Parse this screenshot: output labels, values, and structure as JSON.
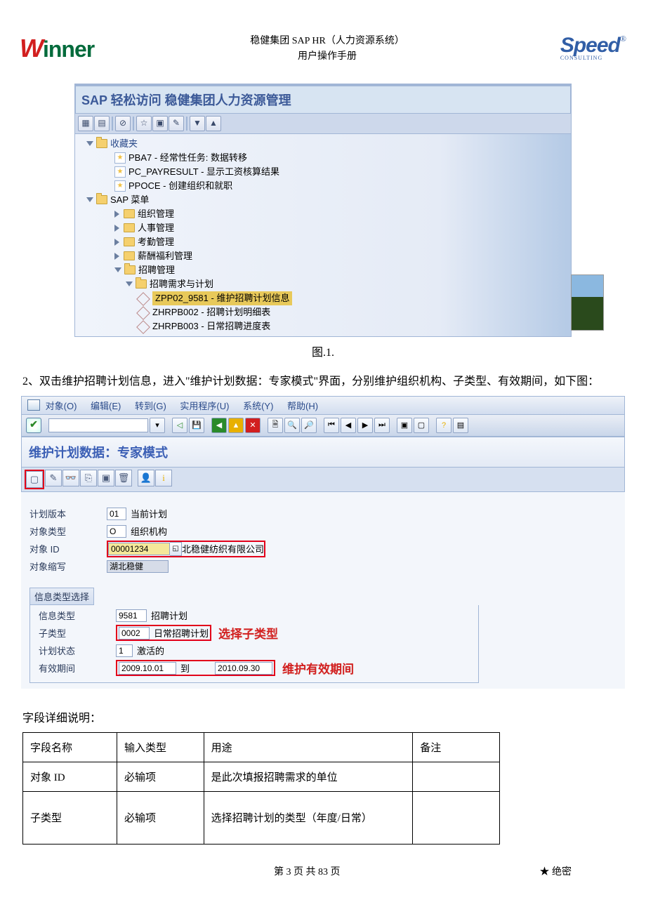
{
  "header": {
    "center_line1": "稳健集团 SAP HR（人力资源系统）",
    "center_line2": "用户操作手册",
    "logo_left": "Winner",
    "logo_right": "Speed",
    "logo_right_sub": "CONSULTING"
  },
  "screenshot1": {
    "title": "SAP 轻松访问 稳健集团人力资源管理",
    "tree": {
      "favorites": "收藏夹",
      "fav1": "PBA7 - 经常性任务: 数据转移",
      "fav2": "PC_PAYRESULT - 显示工资核算结果",
      "fav3": "PPOCE - 创建组织和就职",
      "sapmenu": "SAP 菜单",
      "org": "组织管理",
      "hr": "人事管理",
      "time": "考勤管理",
      "pay": "薪酬福利管理",
      "recruit": "招聘管理",
      "reqplan": "招聘需求与计划",
      "item_highlight": "ZPP02_9581 - 维护招聘计划信息",
      "item2": "ZHRPB002 - 招聘计划明细表",
      "item3": "ZHRPB003 - 日常招聘进度表"
    }
  },
  "figcaption1": "图.1.",
  "paragraph2": "2、双击维护招聘计划信息，进入\"维护计划数据：专家模式\"界面，分别维护组织机构、子类型、有效期间，如下图：",
  "screenshot2": {
    "menu": {
      "obj": "对象(O)",
      "edit": "编辑(E)",
      "goto": "转到(G)",
      "util": "实用程序(U)",
      "sys": "系统(Y)",
      "help": "帮助(H)"
    },
    "mode_title": "维护计划数据：专家模式",
    "form": {
      "plan_version_label": "计划版本",
      "plan_version_value": "01",
      "plan_version_desc": "当前计划",
      "obj_type_label": "对象类型",
      "obj_type_value": "O",
      "obj_type_desc": "组织机构",
      "obj_id_label": "对象 ID",
      "obj_id_value": "00001234",
      "obj_id_desc": "北稳健纺织有限公司",
      "obj_abbr_label": "对象缩写",
      "obj_abbr_value": "湖北稳健",
      "info_select": "信息类型选择",
      "info_type_label": "信息类型",
      "info_type_value": "9581",
      "info_type_desc": "招聘计划",
      "subtype_label": "子类型",
      "subtype_value": "0002",
      "subtype_desc": "日常招聘计划",
      "plan_status_label": "计划状态",
      "plan_status_value": "1",
      "plan_status_desc": "激活的",
      "valid_label": "有效期间",
      "valid_from": "2009.10.01",
      "valid_to_label": "到",
      "valid_to": "2010.09.30",
      "annot_subtype": "选择子类型",
      "annot_valid": "维护有效期间"
    }
  },
  "field_section_title": "字段详细说明：",
  "field_table": {
    "headers": {
      "c1": "字段名称",
      "c2": "输入类型",
      "c3": "用途",
      "c4": "备注"
    },
    "rows": [
      {
        "c1": "对象 ID",
        "c2": "必输项",
        "c3": "是此次填报招聘需求的单位",
        "c4": ""
      },
      {
        "c1": "子类型",
        "c2": "必输项",
        "c3": "选择招聘计划的类型（年度/日常）",
        "c4": ""
      }
    ]
  },
  "footer": {
    "center": "第 3 页 共 83 页",
    "right": "★ 绝密"
  }
}
